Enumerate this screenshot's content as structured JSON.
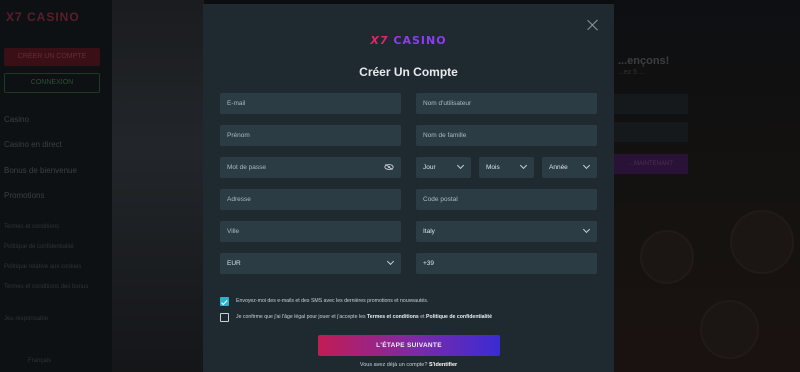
{
  "background": {
    "logo": "X7 CASINO",
    "create_account": "CRÉER UN COMPTE",
    "login": "CONNEXION",
    "nav": [
      "Casino",
      "Casino en direct",
      "Bonus de bienvenue",
      "Promotions"
    ],
    "links": [
      "Termes et conditions",
      "Politique de confidentialité",
      "Politique relative aux cookies",
      "Termes et conditions des bonus",
      "Jeu responsable"
    ],
    "language": "Français",
    "right_title": "...ençons!",
    "right_sub": "...ez 5 ...",
    "right_button": "...MAINTENANT",
    "right_link": "...vez oublié"
  },
  "modal": {
    "logo_x7": "X7",
    "logo_casino": "CASINO",
    "title": "Créer Un Compte",
    "fields": {
      "email": "E-mail",
      "username": "Nom d'utilisateur",
      "first_name": "Prénom",
      "last_name": "Nom de famille",
      "password": "Mot de passe",
      "day": "Jour",
      "month": "Mois",
      "year": "Année",
      "address": "Adresse",
      "postal": "Code postal",
      "city": "Ville",
      "country": "Italy",
      "currency": "EUR",
      "phone": "+39"
    },
    "consent_marketing": "Envoyez-moi des e-mails et des SMS avec les dernières promotions et nouveautés.",
    "consent_terms_prefix": "Je confirme que j'ai l'âge légal pour jouer et j'accepte les ",
    "terms_link": "Termes et conditions",
    "consent_and": " et ",
    "privacy_link": "Politique de confidentialité",
    "submit": "L'ÉTAPE SUIVANTE",
    "footer_prefix": "Vous avez déjà un compte? ",
    "footer_link": "S'identifier"
  },
  "colors": {
    "modal_bg": "#1f2a30",
    "field_bg": "#2c3c45",
    "checkbox_checked": "#2bb3c9",
    "submit_gradient": [
      "#c21c54",
      "#3a2bd4"
    ]
  }
}
